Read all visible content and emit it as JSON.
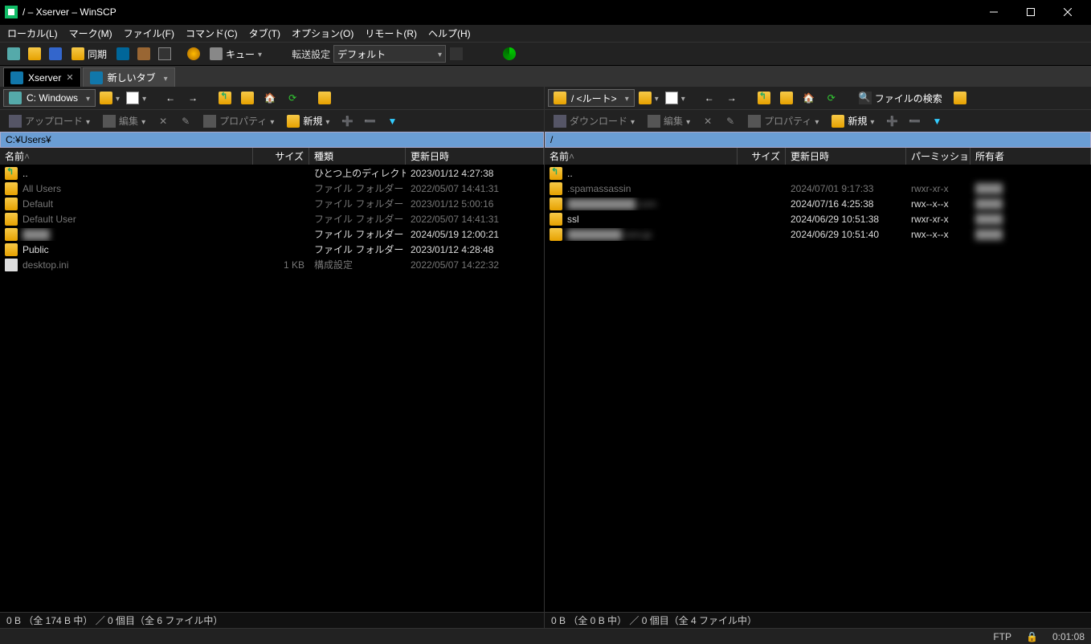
{
  "window": {
    "title": "/ – Xserver – WinSCP"
  },
  "menu": {
    "local": "ローカル(L)",
    "mark": "マーク(M)",
    "file": "ファイル(F)",
    "command": "コマンド(C)",
    "tab": "タブ(T)",
    "option": "オプション(O)",
    "remote": "リモート(R)",
    "help": "ヘルプ(H)"
  },
  "maintoolbar": {
    "sync": "同期",
    "queue": "キュー",
    "transfer_label": "転送設定",
    "transfer_preset": "デフォルト"
  },
  "tabs": {
    "active": "Xserver",
    "new": "新しいタブ"
  },
  "left": {
    "drive": "C: Windows",
    "upload": "アップロード",
    "edit": "編集",
    "property": "プロパティ",
    "new": "新規",
    "path": "C:¥Users¥",
    "cols": {
      "name": "名前",
      "size": "サイズ",
      "type": "種類",
      "modified": "更新日時"
    },
    "rows": [
      {
        "name": "..",
        "icon": "folder-up",
        "size": "",
        "type": "ひとつ上のディレクトリ",
        "mod": "2023/01/12 4:27:38",
        "dim": false
      },
      {
        "name": "All Users",
        "icon": "folder",
        "size": "",
        "type": "ファイル フォルダー",
        "mod": "2022/05/07 14:41:31",
        "dim": true
      },
      {
        "name": "Default",
        "icon": "folder",
        "size": "",
        "type": "ファイル フォルダー",
        "mod": "2023/01/12 5:00:16",
        "dim": true
      },
      {
        "name": "Default User",
        "icon": "folder",
        "size": "",
        "type": "ファイル フォルダー",
        "mod": "2022/05/07 14:41:31",
        "dim": true
      },
      {
        "name": "████",
        "icon": "folder",
        "size": "",
        "type": "ファイル フォルダー",
        "mod": "2024/05/19 12:00:21",
        "dim": false,
        "blur": true
      },
      {
        "name": "Public",
        "icon": "folder",
        "size": "",
        "type": "ファイル フォルダー",
        "mod": "2023/01/12 4:28:48",
        "dim": false
      },
      {
        "name": "desktop.ini",
        "icon": "file",
        "size": "1 KB",
        "type": "構成設定",
        "mod": "2022/05/07 14:22:32",
        "dim": true
      }
    ],
    "footer": "0 B （全 174 B 中） ／ 0 個目（全 6 ファイル中）"
  },
  "right": {
    "drive": "/ <ルート>",
    "download": "ダウンロード",
    "edit": "編集",
    "property": "プロパティ",
    "new": "新規",
    "find": "ファイルの検索",
    "path": "/",
    "cols": {
      "name": "名前",
      "size": "サイズ",
      "modified": "更新日時",
      "perm": "パーミッション",
      "owner": "所有者"
    },
    "rows": [
      {
        "name": "..",
        "icon": "folder-up",
        "size": "",
        "mod": "",
        "perm": "",
        "owner": ""
      },
      {
        "name": ".spamassassin",
        "icon": "folder",
        "size": "",
        "mod": "2024/07/01 9:17:33",
        "perm": "rwxr-xr-x",
        "owner": "████",
        "dim": true
      },
      {
        "name": "██████████.com",
        "icon": "folder",
        "size": "",
        "mod": "2024/07/16 4:25:38",
        "perm": "rwx--x--x",
        "owner": "████",
        "blur": true
      },
      {
        "name": "ssl",
        "icon": "folder",
        "size": "",
        "mod": "2024/06/29 10:51:38",
        "perm": "rwxr-xr-x",
        "owner": "████"
      },
      {
        "name": "████████.xsrv.jp",
        "icon": "folder",
        "size": "",
        "mod": "2024/06/29 10:51:40",
        "perm": "rwx--x--x",
        "owner": "████",
        "blur": true
      }
    ],
    "footer": "0 B （全 0 B 中） ／ 0 個目（全 4 ファイル中）"
  },
  "status": {
    "protocol": "FTP",
    "time": "0:01:08"
  },
  "colwidths": {
    "left": {
      "name": 315,
      "size": 70,
      "type": 120,
      "mod": 170
    },
    "right": {
      "name": 240,
      "size": 60,
      "mod": 150,
      "perm": 80,
      "owner": 100
    }
  }
}
